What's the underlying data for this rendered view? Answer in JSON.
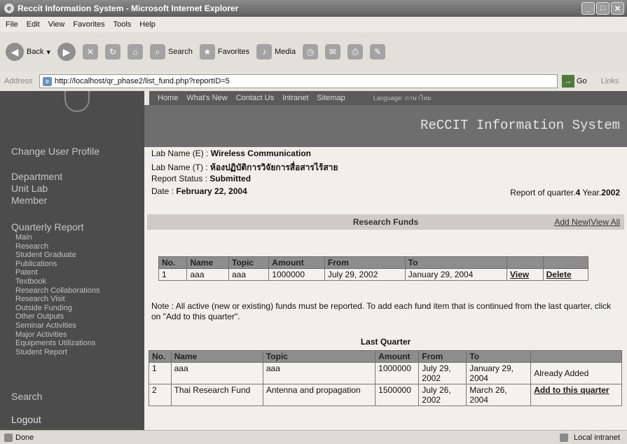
{
  "window": {
    "title": "Reccit Information System - Microsoft Internet Explorer"
  },
  "menu": [
    "File",
    "Edit",
    "View",
    "Favorites",
    "Tools",
    "Help"
  ],
  "toolbar": {
    "back": "Back",
    "search": "Search",
    "favorites": "Favorites",
    "media": "Media"
  },
  "address": {
    "label": "Address",
    "url": "http://localhost/qr_phase2/list_fund.php?reportID=5",
    "go": "Go",
    "links": "Links"
  },
  "nav": {
    "items": [
      "Home",
      "What's New",
      "Contact Us",
      "Intranet",
      "Sitemap"
    ],
    "language": "Language: ภาษาไทย"
  },
  "banner": {
    "title": "ReCCIT Information System"
  },
  "sidebar": {
    "change_profile": "Change User Profile",
    "department": "Department",
    "unit_lab": "Unit Lab",
    "member": "Member",
    "quarterly_report": "Quarterly Report",
    "sub_items": [
      "Main",
      "Research",
      "Student Graduate",
      "Publications",
      "Patent",
      "Textbook",
      "Research Collaborations",
      "Research Visit",
      "Outside Funding",
      "Other Outputs",
      "Seminar Activities",
      "Major Activities",
      "Equipments Utilizations",
      "Student Report"
    ],
    "search": "Search",
    "logout": "Logout"
  },
  "info": {
    "lab_name_e_label": "Lab Name (E) :",
    "lab_name_e": "Wireless Communication",
    "lab_name_t_label": "Lab Name (T) :",
    "lab_name_t": "ห้องปฏิบัติการวิจัยการสื่อสารไร้สาย",
    "status_label": "Report Status :",
    "status": "Submitted",
    "date_label": "Date :",
    "date": "February 22, 2004",
    "quarter_label": "Report of quarter.",
    "quarter": "4",
    "year_label": "Year.",
    "year": "2002"
  },
  "funds": {
    "title": "Research Funds",
    "add_new": "Add New",
    "separator": "|",
    "view_all": "View All",
    "headers": [
      "No.",
      "Name",
      "Topic",
      "Amount",
      "From",
      "To"
    ],
    "rows": [
      {
        "no": "1",
        "name": "aaa",
        "topic": "aaa",
        "amount": "1000000",
        "from": "July 29, 2002",
        "to": "January 29, 2004",
        "view": "View",
        "delete": "Delete"
      }
    ]
  },
  "note": "Note : All active (new or existing) funds must be reported. To add each fund item that is continued from the last quarter, click on \"Add to this quarter\".",
  "last_quarter": {
    "title": "Last Quarter",
    "headers": [
      "No.",
      "Name",
      "Topic",
      "Amount",
      "From",
      "To"
    ],
    "rows": [
      {
        "no": "1",
        "name": "aaa",
        "topic": "aaa",
        "amount": "1000000",
        "from": "July 29, 2002",
        "to": "January 29, 2004",
        "action": "Already Added"
      },
      {
        "no": "2",
        "name": "Thai Research Fund",
        "topic": "Antenna and propagation",
        "amount": "1500000",
        "from": "July 26, 2002",
        "to": "March 26, 2004",
        "action": "Add to this quarter"
      }
    ]
  },
  "status": {
    "text": "Done",
    "zone": "Local intranet"
  }
}
